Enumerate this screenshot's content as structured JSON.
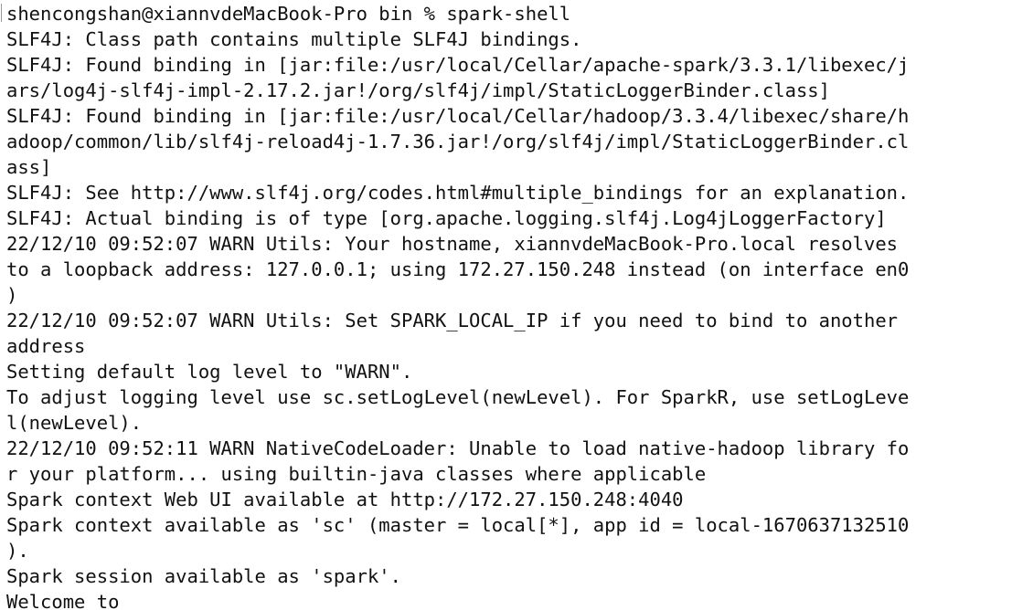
{
  "terminal": {
    "lines": [
      "shencongshan@xiannvdeMacBook-Pro bin % spark-shell",
      "SLF4J: Class path contains multiple SLF4J bindings.",
      "SLF4J: Found binding in [jar:file:/usr/local/Cellar/apache-spark/3.3.1/libexec/j",
      "ars/log4j-slf4j-impl-2.17.2.jar!/org/slf4j/impl/StaticLoggerBinder.class]",
      "SLF4J: Found binding in [jar:file:/usr/local/Cellar/hadoop/3.3.4/libexec/share/h",
      "adoop/common/lib/slf4j-reload4j-1.7.36.jar!/org/slf4j/impl/StaticLoggerBinder.cl",
      "ass]",
      "SLF4J: See http://www.slf4j.org/codes.html#multiple_bindings for an explanation.",
      "SLF4J: Actual binding is of type [org.apache.logging.slf4j.Log4jLoggerFactory]",
      "22/12/10 09:52:07 WARN Utils: Your hostname, xiannvdeMacBook-Pro.local resolves",
      "to a loopback address: 127.0.0.1; using 172.27.150.248 instead (on interface en0",
      ")",
      "22/12/10 09:52:07 WARN Utils: Set SPARK_LOCAL_IP if you need to bind to another",
      "address",
      "Setting default log level to \"WARN\".",
      "To adjust logging level use sc.setLogLevel(newLevel). For SparkR, use setLogLeve",
      "l(newLevel).",
      "22/12/10 09:52:11 WARN NativeCodeLoader: Unable to load native-hadoop library fo",
      "r your platform... using builtin-java classes where applicable",
      "Spark context Web UI available at http://172.27.150.248:4040",
      "Spark context available as 'sc' (master = local[*], app id = local-1670637132510",
      ").",
      "Spark session available as 'spark'.",
      "Welcome to"
    ]
  }
}
